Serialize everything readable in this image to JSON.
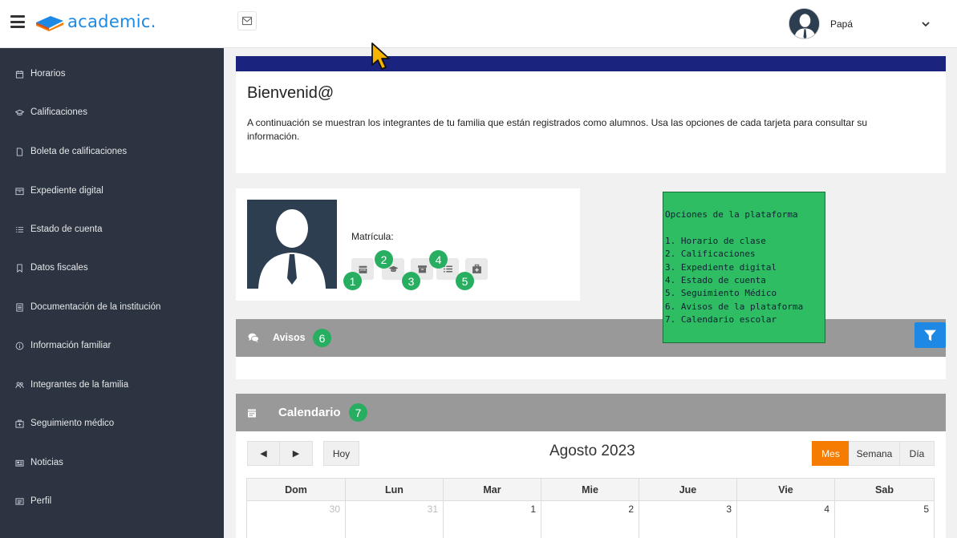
{
  "header": {
    "logo_text": "academic.",
    "user_name": "Papá"
  },
  "sidebar": {
    "items": [
      {
        "label": "Horarios",
        "icon": "calendar-icon"
      },
      {
        "label": "Calificaciones",
        "icon": "graduation-cap-icon"
      },
      {
        "label": "Boleta de calificaciones",
        "icon": "file-icon"
      },
      {
        "label": "Expediente digital",
        "icon": "archive-icon"
      },
      {
        "label": "Estado de cuenta",
        "icon": "list-icon"
      },
      {
        "label": "Datos fiscales",
        "icon": "bookmark-icon"
      },
      {
        "label": "Documentación de la institución",
        "icon": "document-icon"
      },
      {
        "label": "Información familiar",
        "icon": "info-icon"
      },
      {
        "label": "Integrantes de la familia",
        "icon": "users-icon"
      },
      {
        "label": "Seguimiento médico",
        "icon": "medkit-icon"
      },
      {
        "label": "Noticias",
        "icon": "newspaper-icon"
      },
      {
        "label": "Perfil",
        "icon": "id-card-icon"
      }
    ]
  },
  "welcome": {
    "title": "Bienvenid@",
    "text": "A continuación se muestran los integrantes de tu familia que están registrados como alumnos. Usa las opciones de cada tarjeta para consultar su información."
  },
  "student": {
    "matricula_label": "Matrícula:",
    "badges": [
      "1",
      "2",
      "3",
      "4",
      "5"
    ]
  },
  "note": {
    "title": "Opciones de la plataforma",
    "lines": [
      "1. Horario de clase",
      "2. Calificaciones",
      "3. Expediente digital",
      "4. Estado de cuenta",
      "5. Seguimiento Médico",
      "6. Avisos de la plataforma",
      "7. Calendario escolar"
    ]
  },
  "avisos": {
    "label": "Avisos",
    "badge": "6"
  },
  "calendar": {
    "label": "Calendario",
    "badge": "7",
    "today_label": "Hoy",
    "prev_label": "◀",
    "next_label": "▶",
    "title": "Agosto 2023",
    "views": [
      "Mes",
      "Semana",
      "Día"
    ],
    "active_view": "Mes",
    "weekdays": [
      "Dom",
      "Lun",
      "Mar",
      "Mie",
      "Jue",
      "Vie",
      "Sab"
    ],
    "first_row": [
      {
        "day": "30",
        "other": true
      },
      {
        "day": "31",
        "other": true
      },
      {
        "day": "1",
        "other": false
      },
      {
        "day": "2",
        "other": false
      },
      {
        "day": "3",
        "other": false
      },
      {
        "day": "4",
        "other": false
      },
      {
        "day": "5",
        "other": false
      }
    ]
  },
  "colors": {
    "sidebar_bg": "#2b3440",
    "welcome_bar": "#1a237e",
    "badge_green": "#27ae60",
    "note_bg": "#2ebd63",
    "filter_blue": "#1e88e5",
    "active_orange": "#f57c00"
  }
}
